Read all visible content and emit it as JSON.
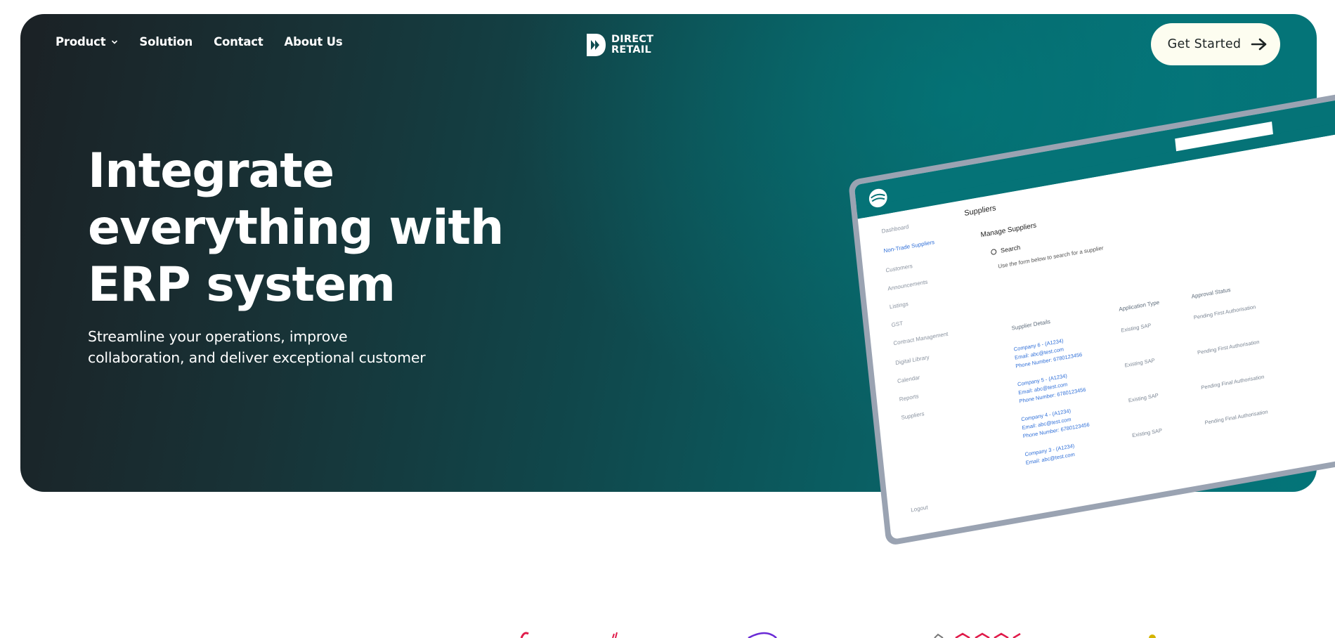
{
  "nav": {
    "items": [
      {
        "label": "Product",
        "has_dropdown": true
      },
      {
        "label": "Solution"
      },
      {
        "label": "Contact"
      },
      {
        "label": "About Us"
      }
    ]
  },
  "logo": {
    "line1": "DIRECT",
    "line2": "RETAIL"
  },
  "cta": {
    "label": "Get Started"
  },
  "hero": {
    "headline_line1": "Integrate",
    "headline_line2": "everything with",
    "headline_line3": "ERP system",
    "subheading_line1": "Streamline your operations, improve",
    "subheading_line2": "collaboration, and deliver exceptional customer"
  },
  "mockup": {
    "page_title": "Suppliers",
    "sidebar": [
      "Dashboard",
      "Non-Trade Suppliers",
      "Customers",
      "Announcements",
      "Listings",
      "GST",
      "Contract Management",
      "Digital Library",
      "Calendar",
      "Reports",
      "Suppliers"
    ],
    "section_title": "Manage Suppliers",
    "search_label": "Search",
    "helper_text": "Use the form below to search for a supplier",
    "columns": [
      "Supplier Details",
      "Application Type",
      "Approval Status"
    ],
    "rows": [
      {
        "company": "Company 6 - (A1234)",
        "email": "Email: abc@test.com",
        "phone": "Phone Number: 6780123456",
        "type": "Existing SAP",
        "status": "Pending First Authorisation"
      },
      {
        "company": "Company 5 - (A1234)",
        "email": "Email: abc@test.com",
        "phone": "Phone Number: 6780123456",
        "type": "Existing SAP",
        "status": "Pending First Authorisation"
      },
      {
        "company": "Company 4 - (A1234)",
        "email": "Email: abc@test.com",
        "phone": "Phone Number: 6780123456",
        "type": "Existing SAP",
        "status": "Pending Final Authorisation"
      },
      {
        "company": "Company 3 - (A1234)",
        "email": "Email: abc@test.com",
        "phone": "",
        "type": "Existing SAP",
        "status": "Pending Final Authorisation"
      }
    ],
    "logout": "Logout"
  },
  "colors": {
    "accent_teal": "#057377",
    "dark": "#1b2125",
    "cta_bg": "#fdfdf0",
    "link_blue": "#2f6fd8"
  },
  "icons": [
    "chevron-down-icon",
    "arrow-right-icon",
    "direct-retail-logo-icon",
    "search-icon"
  ]
}
